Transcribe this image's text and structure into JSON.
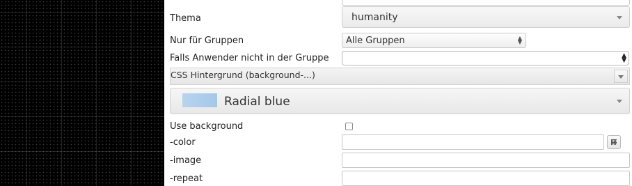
{
  "form": {
    "theme": {
      "label": "Thema",
      "value": "humanity",
      "icon": "chevron-down-icon"
    },
    "groups": {
      "label": "Nur für Gruppen",
      "value": "Alle Gruppen",
      "icon": "updown-arrows-icon"
    },
    "fallback": {
      "label": "Falls Anwender nicht in der Gruppe",
      "value": "",
      "icon": "updown-arrows-icon"
    },
    "css_background": {
      "label": "CSS Hintergrund (background-...)",
      "icon": "chevron-down-icon"
    },
    "preset": {
      "value": "Radial blue",
      "swatch_color": "#aecdea",
      "icon": "chevron-down-icon"
    },
    "use_background": {
      "label": "Use background",
      "checked": false
    },
    "color": {
      "label": "-color",
      "value": "",
      "button_icon": "grid-icon"
    },
    "image": {
      "label": "-image",
      "value": ""
    },
    "repeat": {
      "label": "-repeat",
      "value": ""
    }
  }
}
